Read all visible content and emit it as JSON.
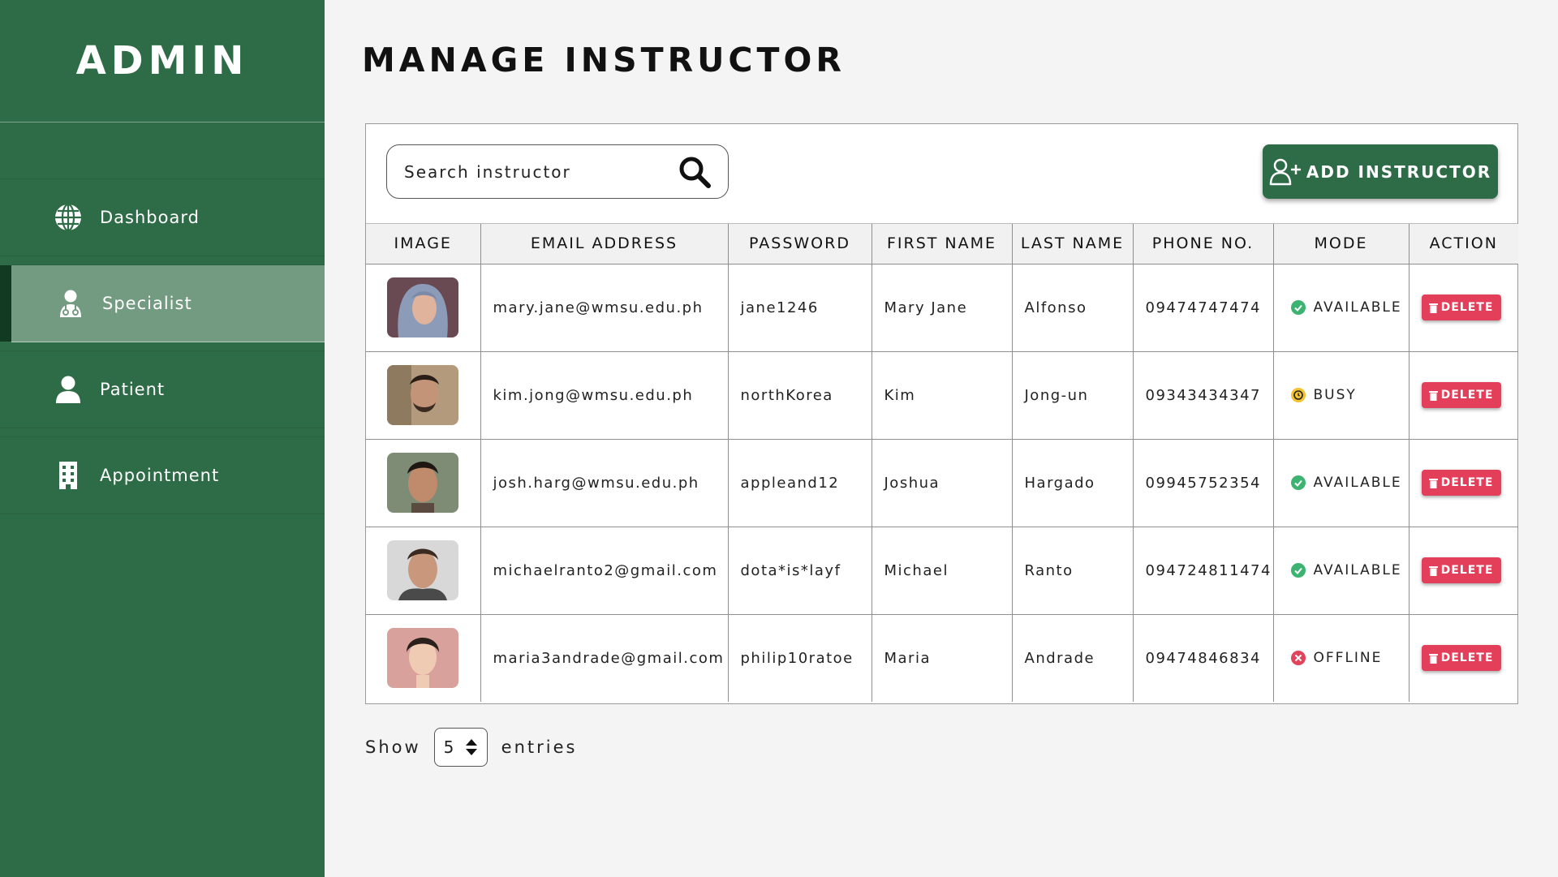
{
  "sidebar": {
    "brand": "ADMIN",
    "items": [
      {
        "label": "Dashboard",
        "icon": "globe-icon",
        "active": false
      },
      {
        "label": "Specialist",
        "icon": "doctor-icon",
        "active": true
      },
      {
        "label": "Patient",
        "icon": "user-icon",
        "active": false
      },
      {
        "label": "Appointment",
        "icon": "building-icon",
        "active": false
      }
    ]
  },
  "main": {
    "title": "MANAGE INSTRUCTOR",
    "search": {
      "placeholder": "Search instructor"
    },
    "add_button": "ADD INSTRUCTOR",
    "table": {
      "columns": [
        "IMAGE",
        "EMAIL ADDRESS",
        "PASSWORD",
        "FIRST NAME",
        "LAST NAME",
        "PHONE NO.",
        "MODE",
        "ACTION"
      ],
      "rows": [
        {
          "email": "mary.jane@wmsu.edu.ph",
          "password": "jane1246",
          "first": "Mary Jane",
          "last": "Alfonso",
          "phone": "09474747474",
          "mode": "AVAILABLE",
          "action": "DELETE"
        },
        {
          "email": "kim.jong@wmsu.edu.ph",
          "password": "northKorea",
          "first": "Kim",
          "last": "Jong-un",
          "phone": "09343434347",
          "mode": "BUSY",
          "action": "DELETE"
        },
        {
          "email": "josh.harg@wmsu.edu.ph",
          "password": "appleand12",
          "first": "Joshua",
          "last": "Hargado",
          "phone": "09945752354",
          "mode": "AVAILABLE",
          "action": "DELETE"
        },
        {
          "email": "michaelranto2@gmail.com",
          "password": "dota*is*layf",
          "first": "Michael",
          "last": "Ranto",
          "phone": "094724811474",
          "mode": "AVAILABLE",
          "action": "DELETE"
        },
        {
          "email": "maria3andrade@gmail.com",
          "password": "philip10ratoe",
          "first": "Maria",
          "last": "Andrade",
          "phone": "09474846834",
          "mode": "OFFLINE",
          "action": "DELETE"
        }
      ]
    },
    "footer": {
      "show": "Show",
      "value": "5",
      "entries": "entries"
    }
  },
  "colors": {
    "sidebar": "#2e6b47",
    "active_item": "#739b82",
    "available": "#3cb371",
    "busy": "#f2c230",
    "offline": "#e0435a",
    "delete": "#e43f5a"
  }
}
